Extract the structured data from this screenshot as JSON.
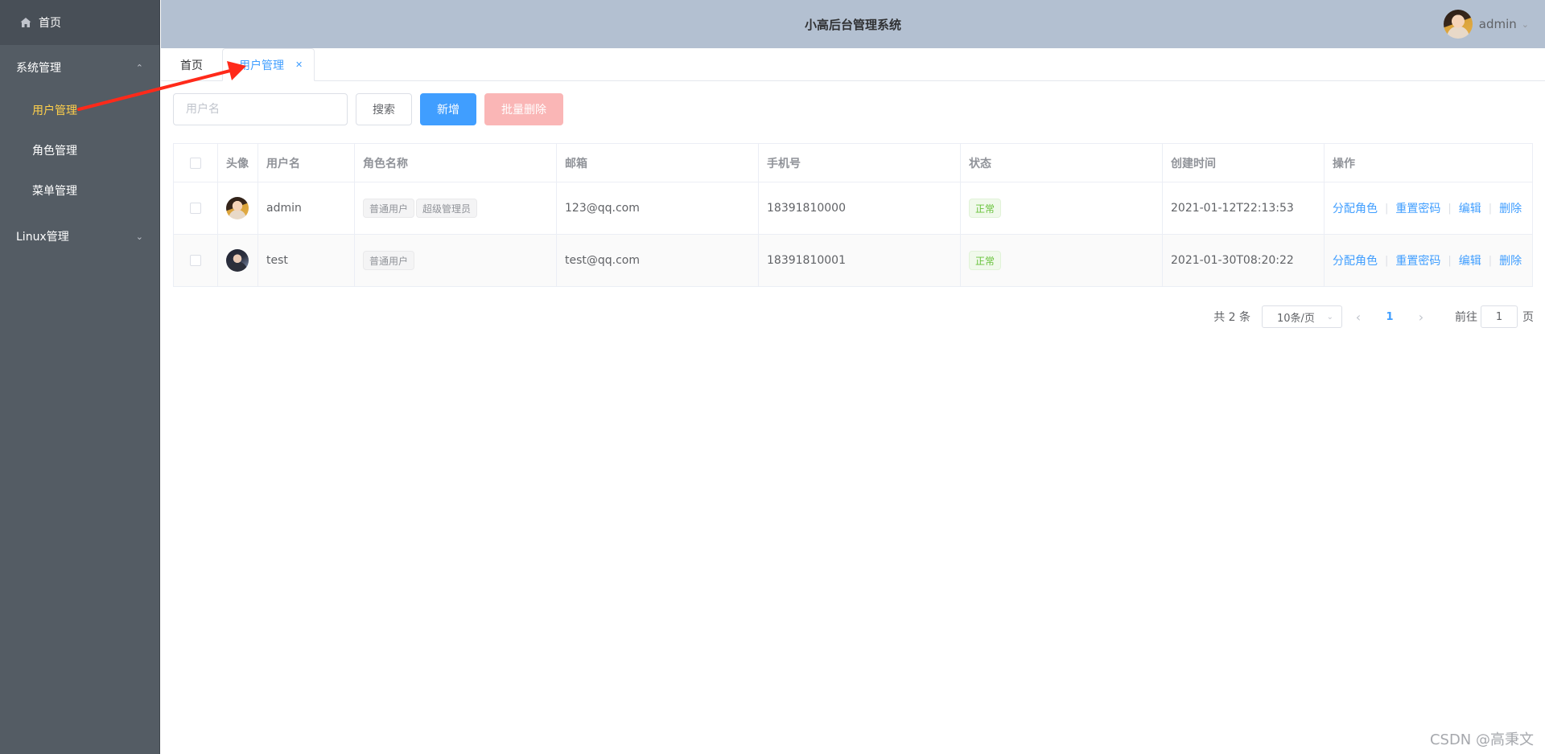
{
  "sidebar": {
    "home": "首页",
    "groups": [
      {
        "label": "系统管理",
        "items": [
          "用户管理",
          "角色管理",
          "菜单管理"
        ]
      },
      {
        "label": "Linux管理"
      }
    ]
  },
  "header": {
    "title": "小高后台管理系统",
    "username": "admin"
  },
  "tabs": [
    "首页",
    "用户管理"
  ],
  "toolbar": {
    "search_placeholder": "用户名",
    "search_label": "搜索",
    "add_label": "新增",
    "batch_delete_label": "批量删除"
  },
  "table": {
    "columns": [
      "头像",
      "用户名",
      "角色名称",
      "邮箱",
      "手机号",
      "状态",
      "创建时间",
      "操作"
    ],
    "rows": [
      {
        "username": "admin",
        "roles": [
          "普通用户",
          "超级管理员"
        ],
        "email": "123@qq.com",
        "phone": "18391810000",
        "status": "正常",
        "created": "2021-01-12T22:13:53"
      },
      {
        "username": "test",
        "roles": [
          "普通用户"
        ],
        "email": "test@qq.com",
        "phone": "18391810001",
        "status": "正常",
        "created": "2021-01-30T08:20:22"
      }
    ],
    "actions": [
      "分配角色",
      "重置密码",
      "编辑",
      "删除"
    ]
  },
  "pagination": {
    "total": "共 2 条",
    "page_size": "10条/页",
    "current": "1",
    "goto_prefix": "前往",
    "goto_value": "1",
    "goto_suffix": "页"
  },
  "watermark": "CSDN @高秉文",
  "colors": {
    "sidebar_bg": "#545c64",
    "header_bg": "#b3c0d1",
    "primary": "#409eff",
    "active_menu": "#ffd04b",
    "annotation_arrow": "#ff2a1a"
  }
}
